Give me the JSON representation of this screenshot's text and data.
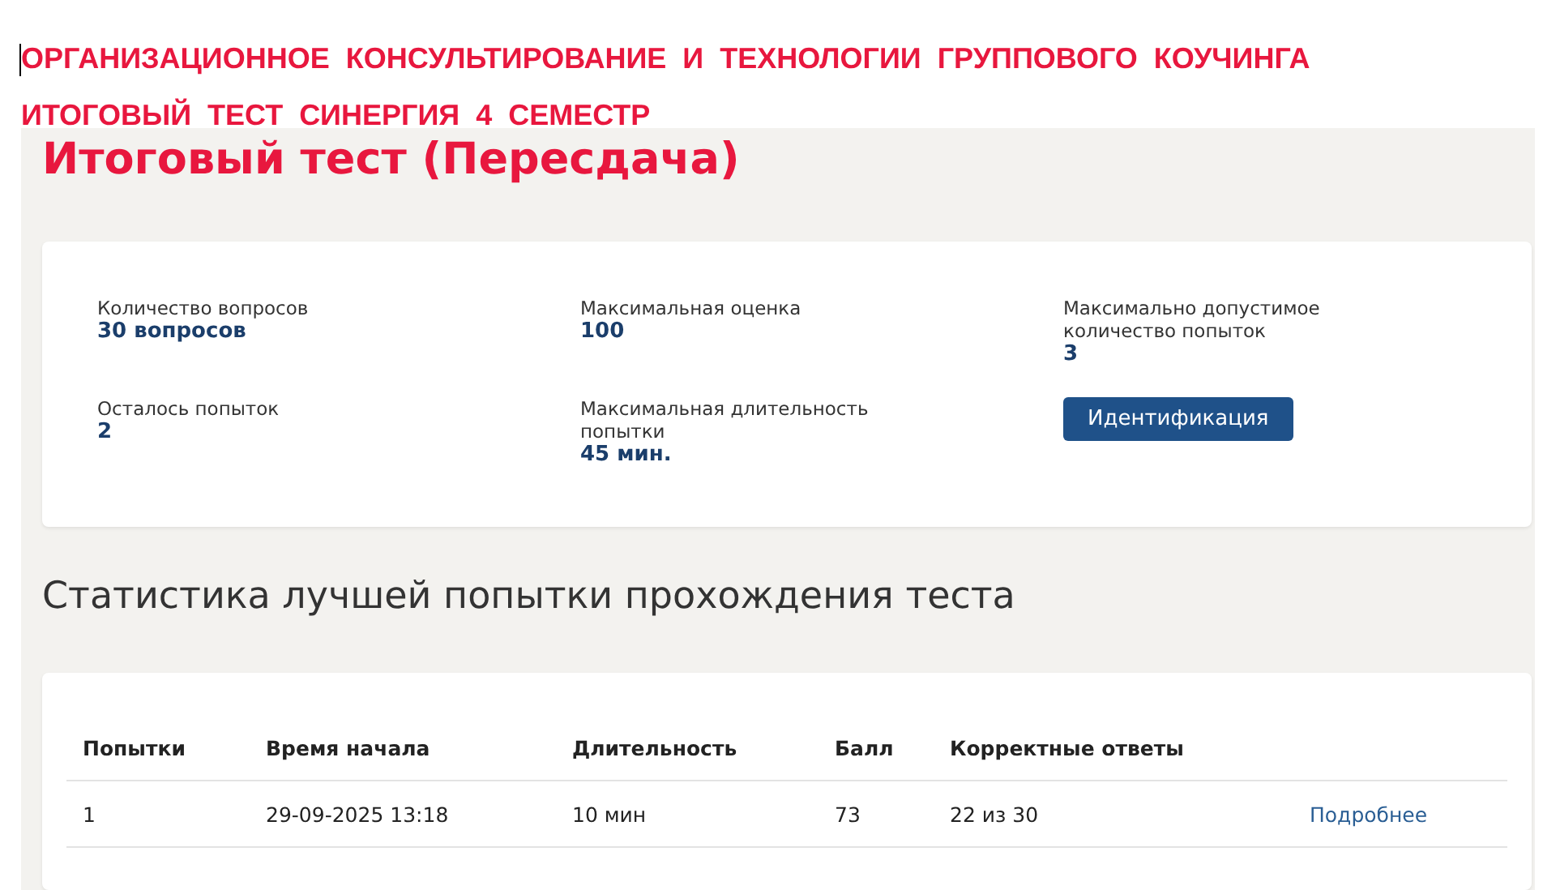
{
  "banner": {
    "lines": [
      "ОРГАНИЗАЦИОННОЕ  КОНСУЛЬТИРОВАНИЕ  И  ТЕХНОЛОГИИ  ГРУППОВОГО  КОУЧИНГА",
      "ИТОГОВЫЙ  ТЕСТ  СИНЕРГИЯ  4  СЕМЕСТР"
    ]
  },
  "page_title": "Итоговый тест (Пересдача)",
  "info": {
    "items": [
      {
        "label": "Количество вопросов",
        "value": "30 вопросов"
      },
      {
        "label": "Максимальная оценка",
        "value": "100"
      },
      {
        "label": "Максимально допустимое количество попыток",
        "value": "3"
      },
      {
        "label": "Осталось попыток",
        "value": "2"
      },
      {
        "label": "Максимальная длительность попытки",
        "value": "45 мин."
      }
    ],
    "button": "Идентификация"
  },
  "stats_title": "Статистика лучшей попытки прохождения теста",
  "table": {
    "columns": [
      "Попытки",
      "Время начала",
      "Длительность",
      "Балл",
      "Корректные ответы"
    ],
    "rows": [
      {
        "cells": [
          "1",
          "29-09-2025 13:18",
          "10 мин",
          "73",
          "22 из 30"
        ],
        "link": "Подробнее"
      }
    ]
  }
}
